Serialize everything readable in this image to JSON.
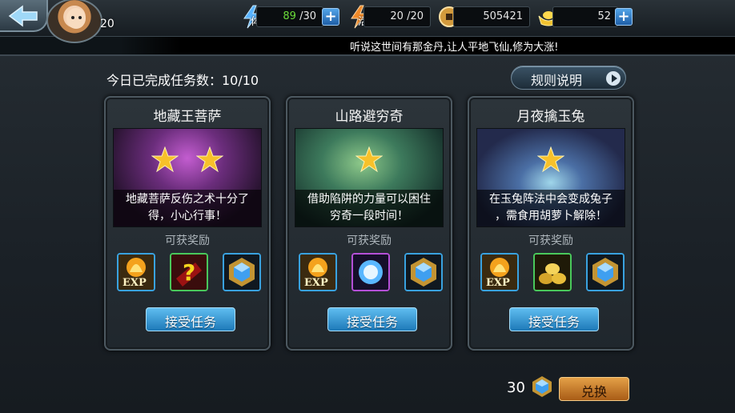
{
  "player": {
    "level": "20"
  },
  "resources": {
    "stamina": {
      "label": "体",
      "current": "89",
      "max": "/30"
    },
    "vitality": {
      "label": "活",
      "value": "20 /20"
    },
    "coins": {
      "value": "505421"
    },
    "gold": {
      "value": "52"
    }
  },
  "marquee": "听说这世间有那金丹,让人平地飞仙,修为大涨!",
  "progress_text": "今日已完成任务数：10/10",
  "rules_button": "规则说明",
  "missions": [
    {
      "title": "地藏王菩萨",
      "stars": 2,
      "desc_line1": "地藏菩萨反伤之术十分了",
      "desc_line2": "得，小心行事！",
      "reward_label": "可获奖励",
      "rewards": [
        "exp-icon",
        "mystery-item-icon",
        "blue-gem-icon"
      ],
      "button": "接受任务"
    },
    {
      "title": "山路避穷奇",
      "stars": 1,
      "desc_line1": "借助陷阱的力量可以困住",
      "desc_line2": "穷奇一段时间！",
      "reward_label": "可获奖励",
      "rewards": [
        "exp-icon",
        "spirit-orb-icon",
        "blue-gem-icon"
      ],
      "button": "接受任务"
    },
    {
      "title": "月夜擒玉兔",
      "stars": 1,
      "desc_line1": "在玉兔阵法中会变成兔子",
      "desc_line2": "，需食用胡萝卜解除！",
      "reward_label": "可获奖励",
      "rewards": [
        "exp-icon",
        "gold-pile-icon",
        "blue-gem-icon"
      ],
      "button": "接受任务"
    }
  ],
  "footer": {
    "gem_count": "30",
    "exchange_button": "兑换"
  },
  "colors": {
    "accent_blue": "#39a2e0",
    "stamina_green": "#6bdc3a",
    "exchange_orange": "#e4a047"
  }
}
